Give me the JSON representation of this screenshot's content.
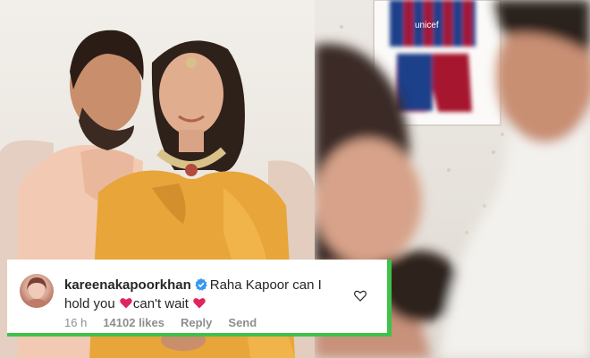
{
  "comment": {
    "username": "kareenakapoorkhan",
    "text_part1": "Raha Kapoor can I hold you",
    "text_part2": "can't wait",
    "time": "16 h",
    "likes": "14102 likes",
    "reply_label": "Reply",
    "send_label": "Send",
    "icons": {
      "verified": "verified-badge-icon",
      "heart_emoji": "red-heart-emoji",
      "like": "heart-outline-icon"
    }
  },
  "jersey": {
    "brand_text": "unicef"
  },
  "colors": {
    "frame_green": "#3ec24a",
    "verified_blue": "#3897f0",
    "heart_red": "#e0245e",
    "jersey_blue": "#1c3f8a",
    "jersey_red": "#a6192e"
  }
}
